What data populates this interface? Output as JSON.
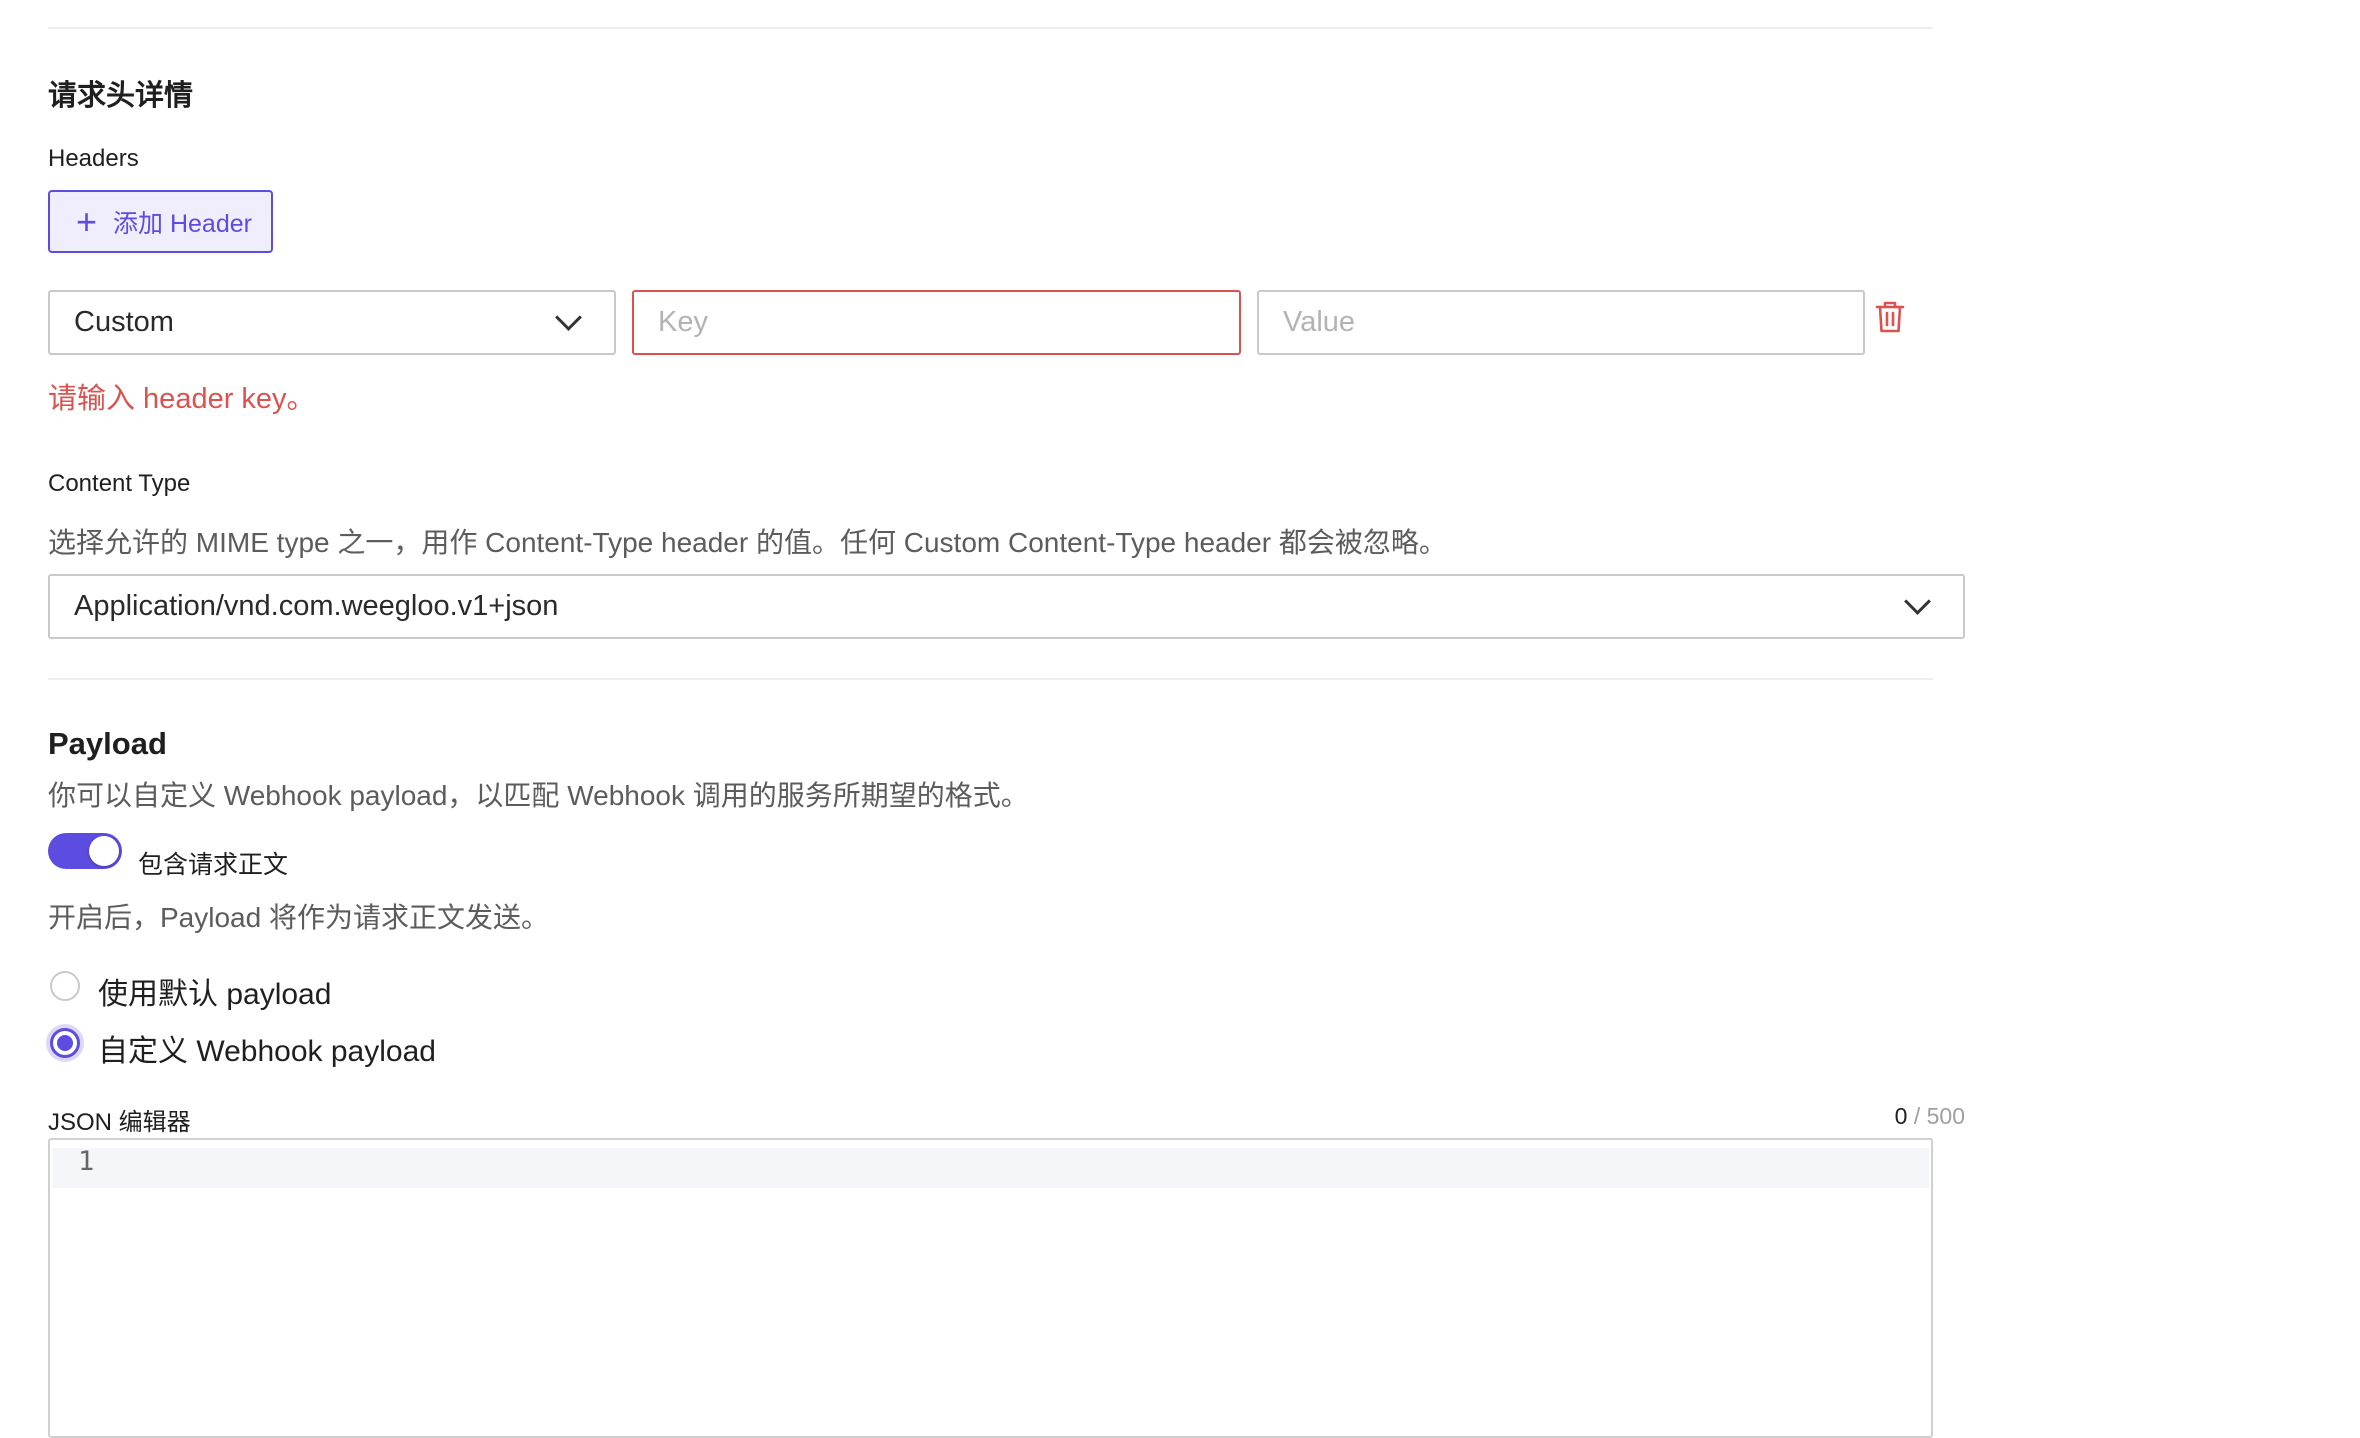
{
  "headers_section": {
    "title": "请求头详情",
    "headers_label": "Headers",
    "add_button_label": "添加 Header",
    "row": {
      "type_value": "Custom",
      "key_placeholder": "Key",
      "value_placeholder": "Value"
    },
    "error_text": "请输入 header key。"
  },
  "content_type": {
    "label": "Content Type",
    "description": "选择允许的 MIME type 之一，用作 Content-Type header 的值。任何 Custom Content-Type header 都会被忽略。",
    "selected": "Application/vnd.com.weegloo.v1+json"
  },
  "payload": {
    "title": "Payload",
    "description": "你可以自定义 Webhook payload，以匹配 Webhook 调用的服务所期望的格式。",
    "toggle_label": "包含请求正文",
    "toggle_on": true,
    "toggle_help": "开启后，Payload 将作为请求正文发送。",
    "radio_default": "使用默认 payload",
    "radio_custom": "自定义 Webhook payload",
    "selected_option": "custom",
    "editor_label": "JSON 编辑器",
    "char_count": "0",
    "char_max": "/ 500",
    "line_number": "1"
  },
  "colors": {
    "accent": "#5d4ce0",
    "error": "#d9534f"
  },
  "icons": {
    "add": "plus-icon",
    "select": "chevron-down-icon",
    "delete": "trash-icon"
  }
}
